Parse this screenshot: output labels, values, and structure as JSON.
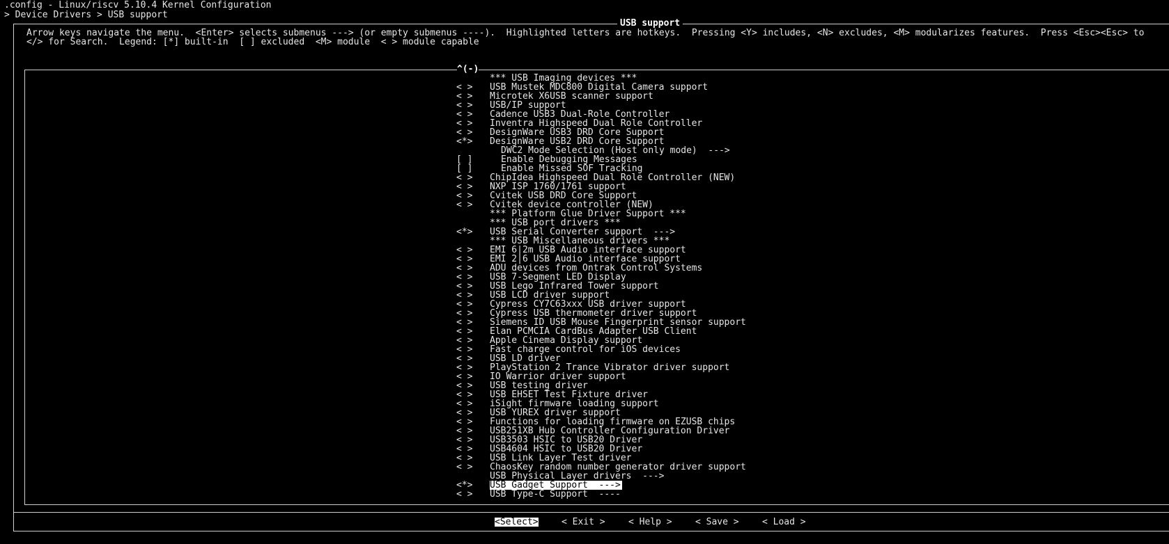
{
  "window": {
    "title": ".config - Linux/riscv 5.10.4 Kernel Configuration",
    "breadcrumb": "> Device Drivers > USB support"
  },
  "dialog": {
    "title": "USB support",
    "help_line_1": "Arrow keys navigate the menu.  <Enter> selects submenus ---> (or empty submenus ----).  Highlighted letters are hotkeys.  Pressing <Y> includes, <N> excludes, <M> modularizes features.  Press <Esc><Esc> to",
    "help_line_2": "</> for Search.  Legend: [*] built-in  [ ] excluded  <M> module  < > module capable",
    "scroll_indicator": "^(-)"
  },
  "menu": {
    "items": [
      {
        "mark": "",
        "label": "*** USB Imaging devices ***",
        "indent": false
      },
      {
        "mark": "< >",
        "label": "USB Mustek MDC800 Digital Camera support",
        "indent": false
      },
      {
        "mark": "< >",
        "label": "Microtek X6USB scanner support",
        "indent": false
      },
      {
        "mark": "< >",
        "label": "USB/IP support",
        "indent": false
      },
      {
        "mark": "< >",
        "label": "Cadence USB3 Dual-Role Controller",
        "indent": false
      },
      {
        "mark": "< >",
        "label": "Inventra Highspeed Dual Role Controller",
        "indent": false
      },
      {
        "mark": "< >",
        "label": "DesignWare USB3 DRD Core Support",
        "indent": false
      },
      {
        "mark": "<*>",
        "label": "DesignWare USB2 DRD Core Support",
        "indent": false
      },
      {
        "mark": "",
        "label": "DWC2 Mode Selection (Host only mode)  --->",
        "indent": true
      },
      {
        "mark": "[ ]",
        "label": "Enable Debugging Messages",
        "indent": true
      },
      {
        "mark": "[ ]",
        "label": "Enable Missed SOF Tracking",
        "indent": true
      },
      {
        "mark": "< >",
        "label": "ChipIdea Highspeed Dual Role Controller (NEW)",
        "indent": false
      },
      {
        "mark": "< >",
        "label": "NXP ISP 1760/1761 support",
        "indent": false
      },
      {
        "mark": "< >",
        "label": "Cvitek USB DRD Core Support",
        "indent": false
      },
      {
        "mark": "< >",
        "label": "Cvitek device controller (NEW)",
        "indent": false
      },
      {
        "mark": "",
        "label": "*** Platform Glue Driver Support ***",
        "indent": false
      },
      {
        "mark": "",
        "label": "*** USB port drivers ***",
        "indent": false
      },
      {
        "mark": "<*>",
        "label": "USB Serial Converter support  --->",
        "indent": false
      },
      {
        "mark": "",
        "label": "*** USB Miscellaneous drivers ***",
        "indent": false
      },
      {
        "mark": "< >",
        "label": "EMI 6|2m USB Audio interface support",
        "indent": false
      },
      {
        "mark": "< >",
        "label": "EMI 2|6 USB Audio interface support",
        "indent": false
      },
      {
        "mark": "< >",
        "label": "ADU devices from Ontrak Control Systems",
        "indent": false
      },
      {
        "mark": "< >",
        "label": "USB 7-Segment LED Display",
        "indent": false
      },
      {
        "mark": "< >",
        "label": "USB Lego Infrared Tower support",
        "indent": false
      },
      {
        "mark": "< >",
        "label": "USB LCD driver support",
        "indent": false
      },
      {
        "mark": "< >",
        "label": "Cypress CY7C63xxx USB driver support",
        "indent": false
      },
      {
        "mark": "< >",
        "label": "Cypress USB thermometer driver support",
        "indent": false
      },
      {
        "mark": "< >",
        "label": "Siemens ID USB Mouse Fingerprint sensor support",
        "indent": false
      },
      {
        "mark": "< >",
        "label": "Elan PCMCIA CardBus Adapter USB Client",
        "indent": false
      },
      {
        "mark": "< >",
        "label": "Apple Cinema Display support",
        "indent": false
      },
      {
        "mark": "< >",
        "label": "Fast charge control for iOS devices",
        "indent": false
      },
      {
        "mark": "< >",
        "label": "USB LD driver",
        "indent": false
      },
      {
        "mark": "< >",
        "label": "PlayStation 2 Trance Vibrator driver support",
        "indent": false
      },
      {
        "mark": "< >",
        "label": "IO Warrior driver support",
        "indent": false
      },
      {
        "mark": "< >",
        "label": "USB testing driver",
        "indent": false
      },
      {
        "mark": "< >",
        "label": "USB EHSET Test Fixture driver",
        "indent": false
      },
      {
        "mark": "< >",
        "label": "iSight firmware loading support",
        "indent": false
      },
      {
        "mark": "< >",
        "label": "USB YUREX driver support",
        "indent": false
      },
      {
        "mark": "< >",
        "label": "Functions for loading firmware on EZUSB chips",
        "indent": false
      },
      {
        "mark": "< >",
        "label": "USB251XB Hub Controller Configuration Driver",
        "indent": false
      },
      {
        "mark": "< >",
        "label": "USB3503 HSIC to USB20 Driver",
        "indent": false
      },
      {
        "mark": "< >",
        "label": "USB4604 HSIC to USB20 Driver",
        "indent": false
      },
      {
        "mark": "< >",
        "label": "USB Link Layer Test driver",
        "indent": false
      },
      {
        "mark": "< >",
        "label": "ChaosKey random number generator driver support",
        "indent": false
      },
      {
        "mark": "",
        "label": "USB Physical Layer drivers  --->",
        "indent": false
      },
      {
        "mark": "<*>",
        "label": "USB Gadget Support  --->",
        "indent": false,
        "selected": true
      },
      {
        "mark": "< >",
        "label": "USB Type-C Support  ----",
        "indent": false
      }
    ]
  },
  "buttons": {
    "select": "<Select>",
    "exit": "< Exit >",
    "help": "< Help >",
    "save": "< Save >",
    "load": "< Load >"
  }
}
